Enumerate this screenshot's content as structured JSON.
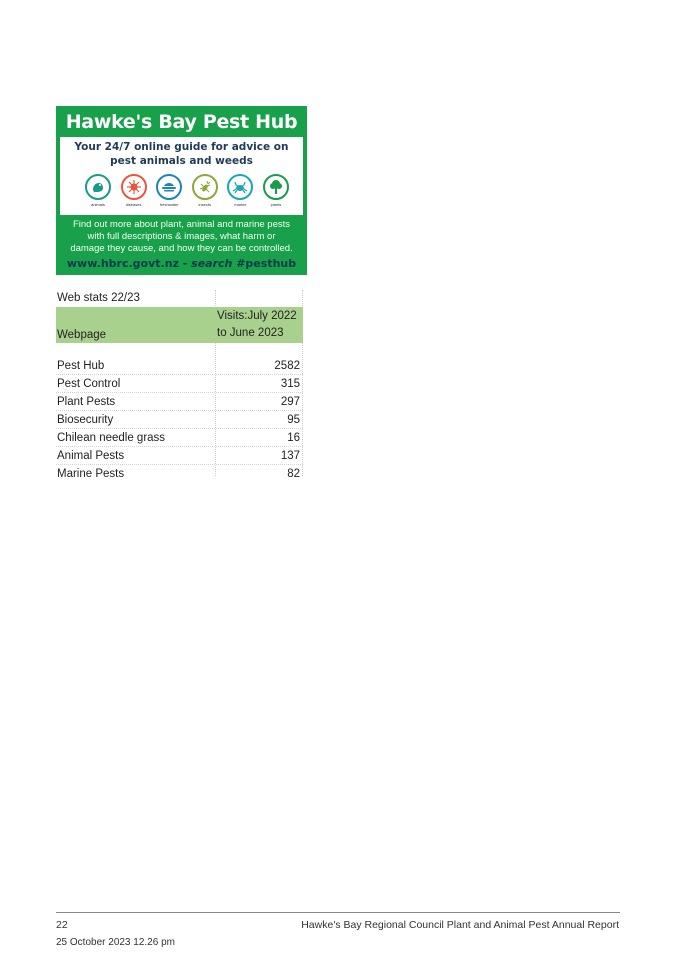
{
  "banner": {
    "title": "Hawke's Bay Pest Hub",
    "tagline_line1": "Your 24/7 online guide for advice on",
    "tagline_line2": "pest animals and weeds",
    "icons": [
      {
        "name": "animals",
        "icon": "animal-icon",
        "glyph": "🐾",
        "color": "#1a9a8a"
      },
      {
        "name": "diseases",
        "icon": "virus-icon",
        "glyph": "✹",
        "color": "#e8563f"
      },
      {
        "name": "freshwater",
        "icon": "water-plant-icon",
        "glyph": "≋",
        "color": "#1a86b5"
      },
      {
        "name": "insects",
        "icon": "insect-icon",
        "glyph": "✱",
        "color": "#8aa83a"
      },
      {
        "name": "marine",
        "icon": "crab-icon",
        "glyph": "✲",
        "color": "#1aa7b5"
      },
      {
        "name": "plants",
        "icon": "tree-icon",
        "glyph": "♣",
        "color": "#1a9a4a"
      }
    ],
    "body_line1": "Find out more about plant, animal and marine pests",
    "body_line2": "with full descriptions & images, what harm or",
    "body_line3": "damage they cause, and how they can be controlled.",
    "url": "www.hbrc.govt.nz - ",
    "url_search": "search",
    "url_tag": " #pesthub",
    "colors": {
      "green": "#18a14a",
      "navy": "#1f3b57"
    }
  },
  "stats": {
    "title": "Web stats 22/23",
    "header_webpage": "Webpage",
    "header_visits_line1": "Visits:July 2022",
    "header_visits_line2": "to June 2023",
    "header_color": "#a9d18e",
    "rows": [
      {
        "page": "Pest Hub",
        "visits": "2582"
      },
      {
        "page": "Pest Control",
        "visits": "315"
      },
      {
        "page": "Plant Pests",
        "visits": "297"
      },
      {
        "page": "Biosecurity",
        "visits": "95"
      },
      {
        "page": "Chilean needle grass",
        "visits": "16"
      },
      {
        "page": "Animal Pests",
        "visits": "137"
      },
      {
        "page": "Marine Pests",
        "visits": "82"
      }
    ]
  },
  "footer": {
    "page_number": "22",
    "report_title": "Hawke's Bay Regional Council Plant and Animal Pest Annual Report",
    "date": "25 October 2023 12.26 pm"
  }
}
